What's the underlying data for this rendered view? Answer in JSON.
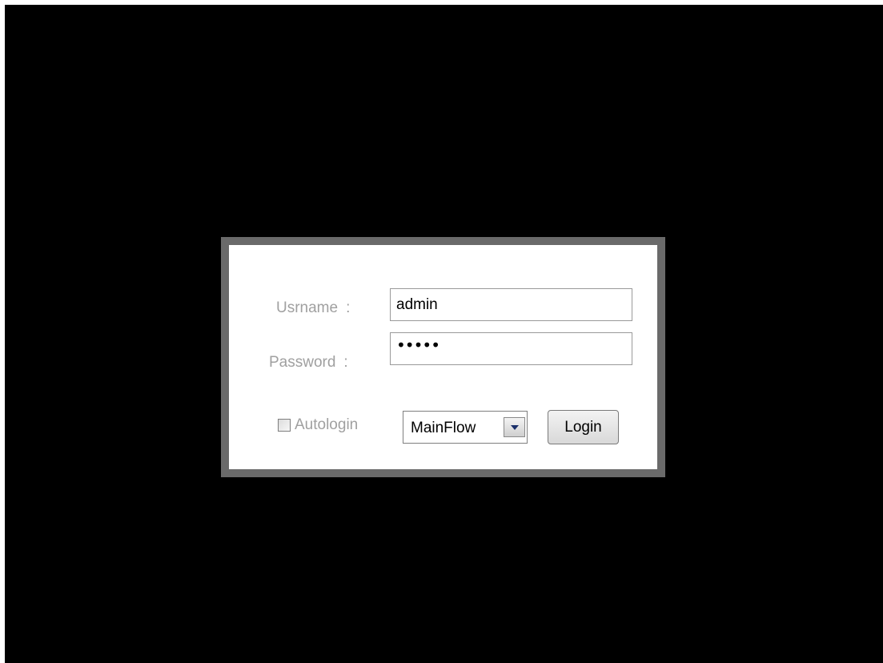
{
  "login": {
    "username_label": "Usrname",
    "password_label": "Password",
    "colon": ":",
    "username_value": "admin",
    "password_masked": "•••••",
    "autologin_label": "Autologin",
    "autologin_checked": false,
    "flow_selected": "MainFlow",
    "login_button": "Login"
  },
  "icons": {
    "select_arrow": "chevron-down-icon"
  },
  "colors": {
    "background": "#000000",
    "frame": "#6a6a6a",
    "panel": "#ffffff",
    "label_text": "#a0a0a0"
  }
}
